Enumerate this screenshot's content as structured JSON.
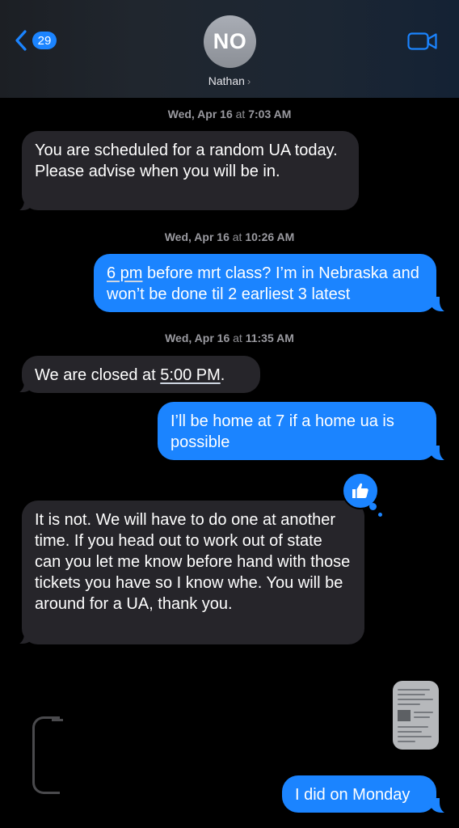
{
  "header": {
    "back_badge_count": "29",
    "avatar_initials": "NO",
    "contact_name": "Nathan",
    "contact_chevron": "›",
    "back_icon": "chevron-left-icon",
    "video_icon": "video-camera-icon",
    "accent_color": "#1b84ff"
  },
  "messages": [
    {
      "type": "timestamp",
      "day": "Wed, Apr 16",
      "at": "at",
      "time": "7:03 AM"
    },
    {
      "type": "incoming",
      "text": "You are scheduled for a random UA today.  Please advise when you will be in."
    },
    {
      "type": "timestamp",
      "day": "Wed, Apr 16",
      "at": "at",
      "time": "10:26 AM"
    },
    {
      "type": "outgoing",
      "text_link": "6 pm",
      "text_rest": " before mrt class? I’m in Nebraska and won’t be done til 2 earliest 3 latest"
    },
    {
      "type": "timestamp",
      "day": "Wed, Apr 16",
      "at": "at",
      "time": "11:35 AM"
    },
    {
      "type": "incoming",
      "text_pre": "We are closed at ",
      "text_link": "5:00 PM",
      "text_post": "."
    },
    {
      "type": "outgoing",
      "text": "I’ll be home at 7 if a home ua is possible"
    },
    {
      "type": "incoming",
      "text": "It is not.  We will have to do one at another time.  If you head out to work out of state can you let me know before hand with those tickets you have so I know whe. You will be around for a UA, thank you.",
      "tapback": "thumbs-up-icon"
    },
    {
      "type": "outgoing-attachment",
      "attachment": "document-thumbnail"
    },
    {
      "type": "outgoing",
      "text": "I did on Monday"
    }
  ]
}
